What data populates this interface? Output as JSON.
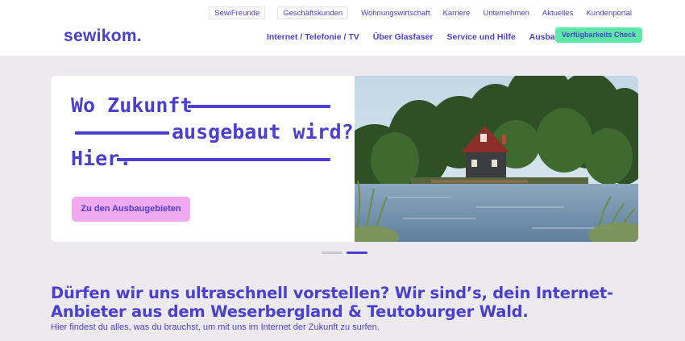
{
  "header": {
    "logo": "sewikom.",
    "top_nav": [
      {
        "label": "SewiFreunde",
        "boxed": true
      },
      {
        "label": "Geschäftskunden",
        "boxed": true
      },
      {
        "label": "Wohnungswirtschaft",
        "boxed": false
      },
      {
        "label": "Karriere",
        "boxed": false
      },
      {
        "label": "Unternehmen",
        "boxed": false
      },
      {
        "label": "Aktuelles",
        "boxed": false
      },
      {
        "label": "Kundenportal",
        "boxed": false
      }
    ],
    "main_nav": [
      {
        "label": "Internet / Telefonie / TV"
      },
      {
        "label": "Über Glasfaser"
      },
      {
        "label": "Service und Hilfe"
      },
      {
        "label": "Ausbaugebiete"
      }
    ],
    "check_button": "Verfügbarkeits Check"
  },
  "hero": {
    "line1": "Wo Zukunft",
    "line2": "ausgebaut wird?",
    "line3": "Hier.",
    "button": "Zu den Ausbaugebieten",
    "image_icon": "house-by-lake-photo"
  },
  "carousel": {
    "slides": 2,
    "active": 2
  },
  "intro": {
    "title": "Dürfen wir uns ultraschnell vorstellen? Wir sind’s, dein Internet-Anbieter aus dem Weserbergland & Teutoburger Wald.",
    "subtitle": "Hier findest du alles, was du brauchst, um mit uns im Internet der Zukunft zu surfen."
  },
  "colors": {
    "brand": "#4a3fd0",
    "accent_green": "#5de8a8",
    "accent_pink": "#f1a9f0",
    "background": "#eceaef"
  }
}
